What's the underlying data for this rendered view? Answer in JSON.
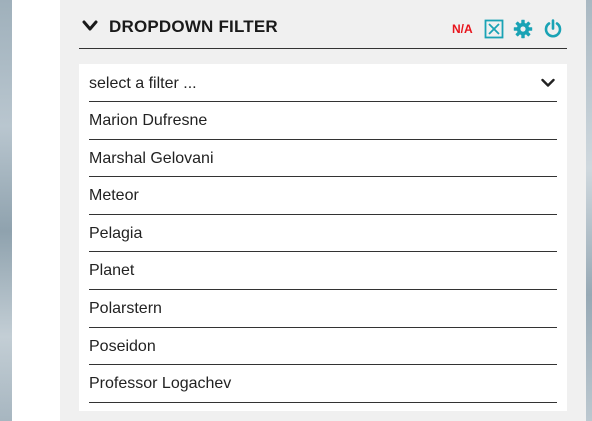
{
  "widget": {
    "title": "DROPDOWN FILTER",
    "status_badge": "N/A"
  },
  "icons": {
    "collapse": "chevron-down-icon",
    "clear": "clear-filter-icon",
    "settings": "gear-icon",
    "power": "power-icon"
  },
  "colors": {
    "accent": "#1aa3b5",
    "badge": "#e8141c",
    "panel_bg": "#f0f0f0"
  },
  "dropdown": {
    "placeholder": "select a filter ...",
    "options": [
      "Marion Dufresne",
      "Marshal Gelovani",
      "Meteor",
      "Pelagia",
      "Planet",
      "Polarstern",
      "Poseidon",
      "Professor Logachev"
    ]
  }
}
